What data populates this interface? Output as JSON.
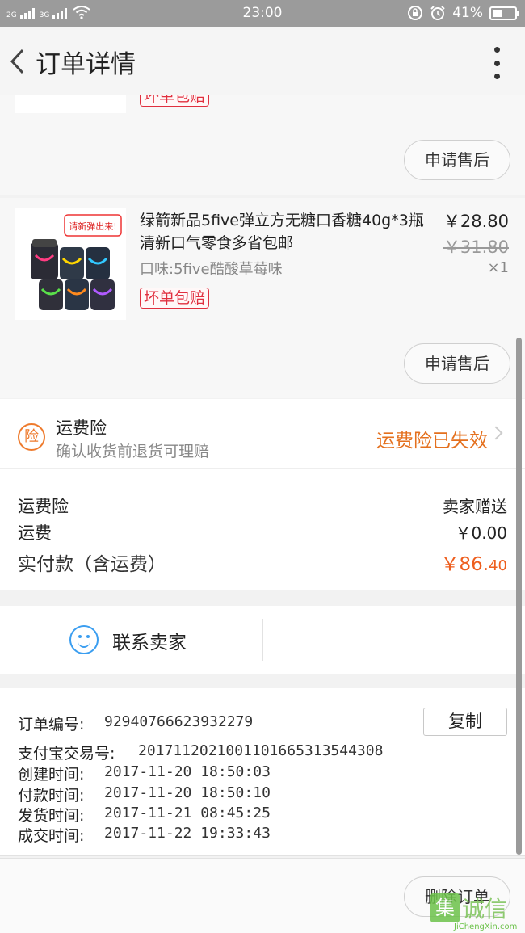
{
  "status_bar": {
    "network_left": "2G",
    "network_right": "3G",
    "time": "23:00",
    "battery": "41%"
  },
  "nav": {
    "title": "订单详情"
  },
  "product_partial": {
    "badge": "坏单包赔",
    "after_sale": "申请售后"
  },
  "product": {
    "title": "绿箭新品5five弹立方无糖口香糖40g*3瓶清新口气零食多省包邮",
    "spec": "口味:5five酷酸草莓味",
    "price": "￥28.80",
    "original_price": "￥31.80",
    "quantity": "×1",
    "badge": "坏单包赔",
    "after_sale": "申请售后",
    "image_banner": "请新弹出来!"
  },
  "insurance": {
    "icon_char": "险",
    "title": "运费险",
    "subtitle": "确认收货前退货可理赔",
    "status": "运费险已失效"
  },
  "costs": {
    "insurance_label": "运费险",
    "insurance_value": "卖家赠送",
    "shipping_label": "运费",
    "shipping_value": "￥0.00",
    "total_label": "实付款（含运费）",
    "total_main": "￥86.",
    "total_cents": "40"
  },
  "contact": {
    "label": "联系卖家"
  },
  "order_info": {
    "order_no_label": "订单编号:",
    "order_no": "92940766623932279",
    "copy_label": "复制",
    "alipay_label": "支付宝交易号:",
    "alipay_no": "2017112021001101665313544308",
    "created_label": "创建时间:",
    "created": "2017-11-20 18:50:03",
    "paid_label": "付款时间:",
    "paid": "2017-11-20 18:50:10",
    "shipped_label": "发货时间:",
    "shipped": "2017-11-21 08:45:25",
    "deal_label": "成交时间:",
    "deal": "2017-11-22 19:33:43"
  },
  "footer": {
    "delete_order": "删除订单"
  },
  "watermark": {
    "logo": "集",
    "text": "诚信",
    "url": "JiChengXin.com"
  },
  "colors": {
    "accent_orange": "#ee5e1e",
    "badge_red": "#e0303f",
    "contact_blue": "#3b9ef0"
  }
}
